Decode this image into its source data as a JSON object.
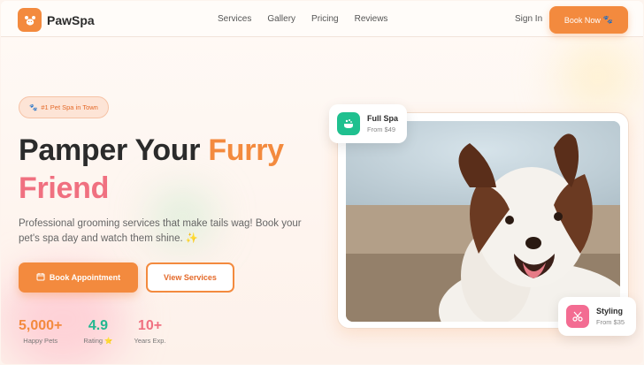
{
  "brand": {
    "name": "PawSpa",
    "logo_icon": "paw-icon"
  },
  "nav": {
    "links": [
      "Services",
      "Gallery",
      "Pricing",
      "Reviews"
    ],
    "sign_in": "Sign In",
    "book_now": "Book Now",
    "book_now_icon": "🐾"
  },
  "hero": {
    "badge_icon": "🐾",
    "badge": "#1 Pet Spa in Town",
    "headline_part1": "Pamper Your ",
    "headline_accent1": "Furry",
    "headline_accent2": "Friend",
    "subtitle": "Professional grooming services that make tails wag! Book your pet's spa day and watch them shine. ✨",
    "primary_button": "Book Appointment",
    "secondary_button": "View Services"
  },
  "stats": [
    {
      "value": "5,000+",
      "label": "Happy Pets"
    },
    {
      "value": "4.9",
      "label": "Rating ⭐"
    },
    {
      "value": "10+",
      "label": "Years Exp."
    }
  ],
  "cards": {
    "spa": {
      "title": "Full Spa",
      "price": "From $49",
      "icon": "bath-icon"
    },
    "styling": {
      "title": "Styling",
      "price": "From $35",
      "icon": "scissors-icon"
    }
  },
  "colors": {
    "primary": "#f38a3e",
    "accent_pink": "#f07080",
    "accent_green": "#22b890",
    "background": "#fdf4ee"
  },
  "photo": {
    "subject": "dog-photo"
  }
}
